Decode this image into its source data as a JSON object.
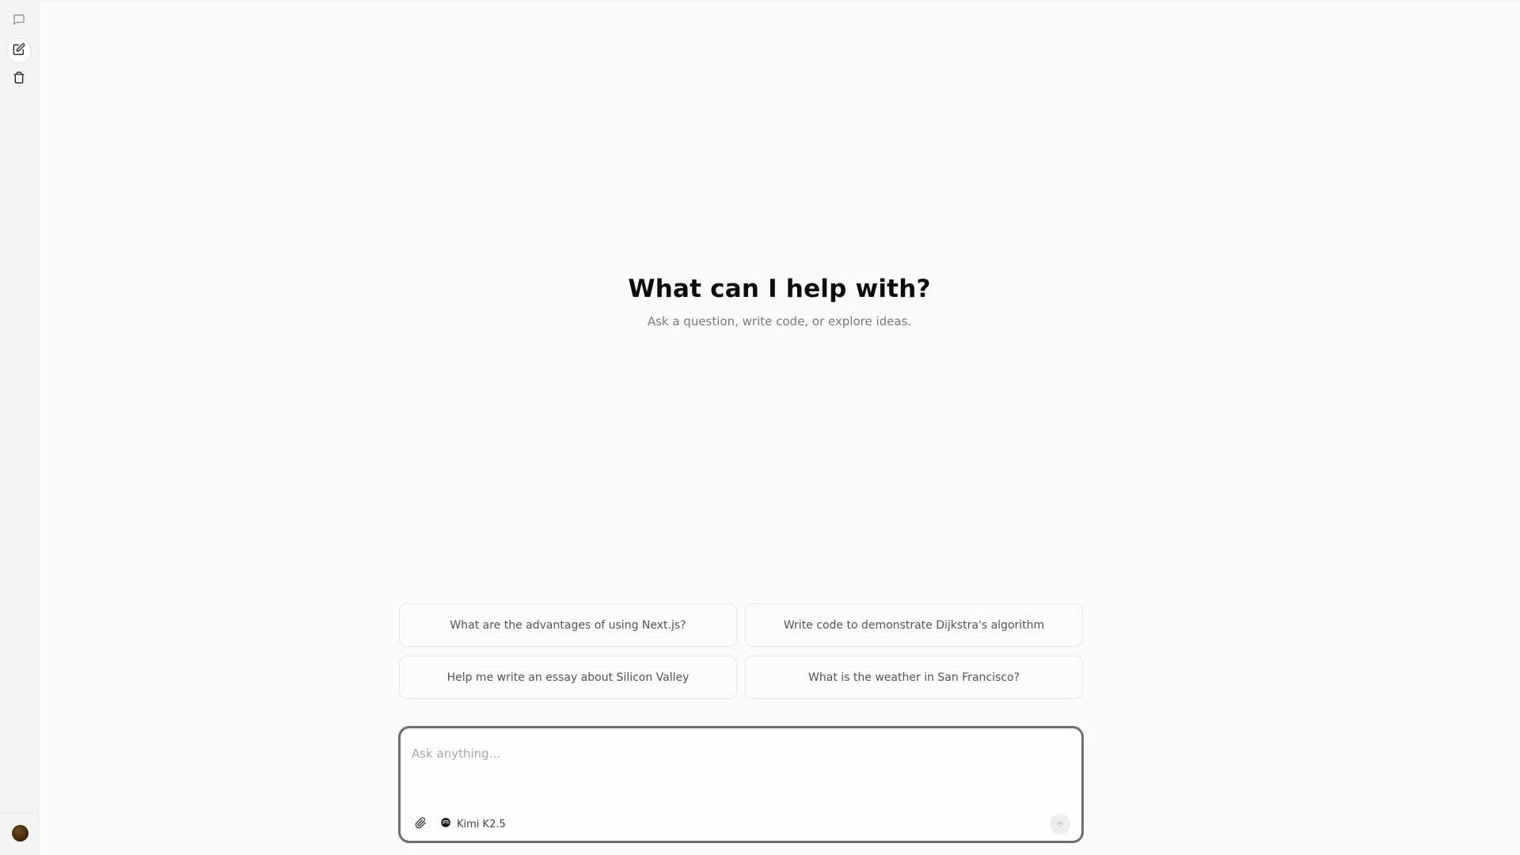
{
  "sidebar": {
    "items": [
      {
        "name": "chats",
        "icon": "chat-bubble-icon"
      },
      {
        "name": "new-chat",
        "icon": "edit-icon"
      },
      {
        "name": "trash",
        "icon": "trash-icon"
      }
    ],
    "avatar_color": "#3a2608"
  },
  "hero": {
    "title": "What can I help with?",
    "subtitle": "Ask a question, write code, or explore ideas."
  },
  "suggestions": [
    "What are the advantages of using Next.js?",
    "Write code to demonstrate Dijkstra's algorithm",
    "Help me write an essay about Silicon Valley",
    "What is the weather in San Francisco?"
  ],
  "composer": {
    "placeholder": "Ask anything...",
    "value": "",
    "attach_icon": "paperclip-icon",
    "model_icon": "kimi-logo-icon",
    "model_label": "Kimi K2.5",
    "send_icon": "arrow-up-icon"
  },
  "colors": {
    "background": "#fafafa",
    "sidebar": "#f4f4f4",
    "composer_border": "#6e6e6e"
  }
}
